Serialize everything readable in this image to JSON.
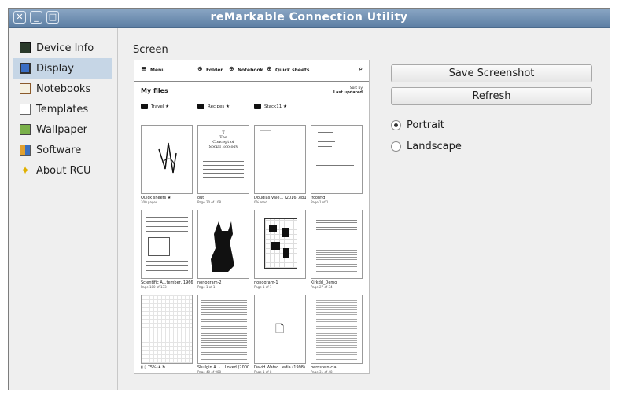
{
  "window": {
    "title": "reMarkable Connection Utility"
  },
  "sidebar": {
    "items": [
      {
        "label": "Device Info",
        "icon": "pulse-monitor-icon",
        "selected": false
      },
      {
        "label": "Display",
        "icon": "monitor-icon",
        "selected": true
      },
      {
        "label": "Notebooks",
        "icon": "notebook-pen-icon",
        "selected": false
      },
      {
        "label": "Templates",
        "icon": "template-pages-icon",
        "selected": false
      },
      {
        "label": "Wallpaper",
        "icon": "wallpaper-icon",
        "selected": false
      },
      {
        "label": "Software",
        "icon": "software-package-icon",
        "selected": false
      },
      {
        "label": "About RCU",
        "icon": "star-icon",
        "selected": false
      }
    ]
  },
  "display": {
    "screen_label": "Screen",
    "save_label": "Save Screenshot",
    "refresh_label": "Refresh",
    "orientation": {
      "portrait": "Portrait",
      "landscape": "Landscape",
      "selected": "portrait"
    }
  },
  "device": {
    "menu": "Menu",
    "folder": "Folder",
    "notebook": "Notebook",
    "quick_sheets": "Quick sheets",
    "heading": "My files",
    "sort_by": "Sort by",
    "sort_value": "Last updated",
    "folders": [
      "Travel",
      "Recipes",
      "Stack11"
    ],
    "docs": [
      {
        "name": "Quick sheets",
        "sub": "300 pages"
      },
      {
        "name": "out",
        "sub": "Page 20 of 108"
      },
      {
        "name": "Douglas Vale... (2016).epub",
        "sub": "0% read"
      },
      {
        "name": "ifconfig",
        "sub": "Page 1 of 1"
      },
      {
        "name": "Scientific A...tember, 1966",
        "sub": "Page 180 of 133"
      },
      {
        "name": "nonogram-2",
        "sub": "Page 1 of 1"
      },
      {
        "name": "nonogram-1",
        "sub": "Page 1 of 1"
      },
      {
        "name": "Kirkdd_Demo",
        "sub": "Page 27 of 34"
      },
      {
        "name": "",
        "sub": ""
      },
      {
        "name": "Shulgin A. - ...Loved (2000)",
        "sub": "Page 40 of 988"
      },
      {
        "name": "David Watso...edia (1998)",
        "sub": "Page 1 of 8"
      },
      {
        "name": "bernstein-cia",
        "sub": "Page 31 of 48"
      }
    ],
    "status_text": "75%"
  }
}
